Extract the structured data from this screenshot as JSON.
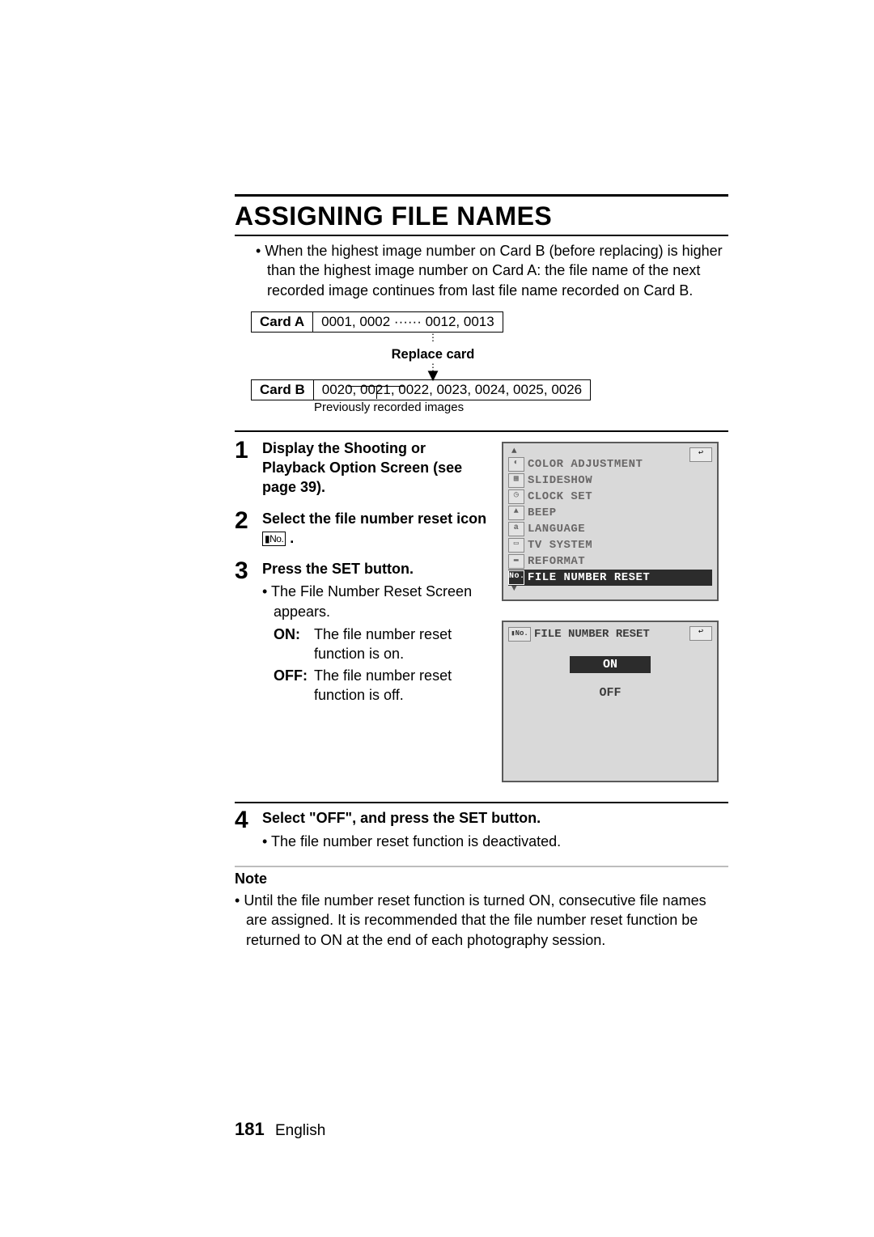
{
  "title": "ASSIGNING FILE NAMES",
  "intro": "When the highest image number on Card B (before replacing) is higher than the highest image number on Card A: the file name of the next recorded image continues from last file name recorded on Card B.",
  "card_table": {
    "a_label": "Card A",
    "a_values": "0001, 0002 ······ 0012, 0013",
    "replace": "Replace card",
    "b_label": "Card B",
    "b_values": "0020, 0021, 0022, 0023, 0024, 0025, 0026",
    "prev_note": "Previously recorded images"
  },
  "file_no_icon": "▮No.",
  "steps": {
    "s1": "Display the Shooting or Playback Option Screen (see page 39).",
    "s2": "Select the file number reset icon",
    "s3": {
      "title": "Press the SET button.",
      "bullet": "The File Number Reset Screen appears.",
      "on_label": "ON:",
      "on_text": "The file number reset function is on.",
      "off_label": "OFF:",
      "off_text": "The file number reset function is off."
    },
    "s4": {
      "title": "Select \"OFF\", and press the SET button.",
      "bullet": "The file number reset function is deactivated."
    }
  },
  "menu1": {
    "items": [
      "COLOR ADJUSTMENT",
      "SLIDESHOW",
      "CLOCK SET",
      "BEEP",
      "LANGUAGE",
      "TV SYSTEM",
      "REFORMAT"
    ],
    "selected": "FILE NUMBER RESET",
    "tab_icon": "↩"
  },
  "menu2": {
    "header": "FILE NUMBER RESET",
    "on": "ON",
    "off": "OFF",
    "tab_icon": "↩"
  },
  "note": {
    "hdr": "Note",
    "text": "Until the file number reset function is turned ON, consecutive file names are assigned. It is recommended that the file number reset function be returned to ON at the end of each photography session."
  },
  "footer": {
    "page": "181",
    "lang": "English"
  }
}
